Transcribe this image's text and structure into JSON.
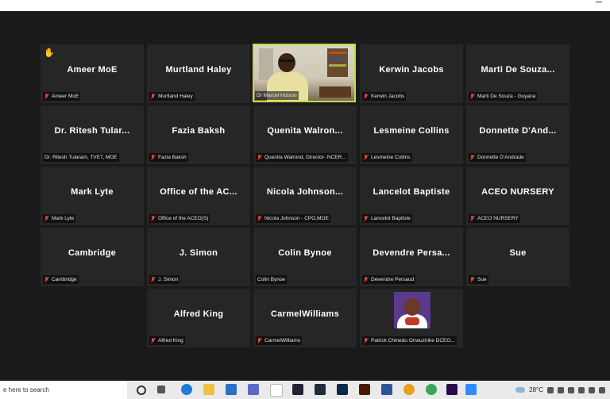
{
  "taskbar": {
    "search_placeholder": "e here to search",
    "weather": "28°C"
  },
  "colors": {
    "active_speaker_border": "#c8d93b",
    "muted_mic": "#e0403a",
    "tile_bg": "#262626",
    "stage_bg": "#1a1a1a"
  },
  "tiles": [
    {
      "name": "Ameer MoE",
      "label": "Ameer MoE",
      "muted": true,
      "hand": true
    },
    {
      "name": "Murtland Haley",
      "label": "Murtland Haley",
      "muted": true
    },
    {
      "name": "",
      "label": "Dr Marcel Hutson",
      "muted": false,
      "video": true
    },
    {
      "name": "Kerwin Jacobs",
      "label": "Kerwin Jacobs",
      "muted": true
    },
    {
      "name": "Marti De Souza...",
      "label": "Marti De Souza - Guyana",
      "muted": true
    },
    {
      "name": "Dr. Ritesh Tular...",
      "label": "Dr. Ritesh Tularam, TVET, MOE",
      "muted": false
    },
    {
      "name": "Fazia Baksh",
      "label": "Fazia Baksh",
      "muted": true
    },
    {
      "name": "Quenita Walron...",
      "label": "Quenita Walrond, Director- NCER...",
      "muted": true
    },
    {
      "name": "Lesmeine Collins",
      "label": "Lesmeine Collins",
      "muted": true
    },
    {
      "name": "Donnette D'And...",
      "label": "Donnette D'Andrade",
      "muted": true
    },
    {
      "name": "Mark Lyte",
      "label": "Mark Lyte",
      "muted": true
    },
    {
      "name": "Office of the AC...",
      "label": "Office of the ACEO(S)",
      "muted": true
    },
    {
      "name": "Nicola Johnson...",
      "label": "Nicola Johnson - CPO,MOE",
      "muted": true
    },
    {
      "name": "Lancelot Baptiste",
      "label": "Lancelot Baptiste",
      "muted": true
    },
    {
      "name": "ACEO NURSERY",
      "label": "ACEO NURSERY",
      "muted": true
    },
    {
      "name": "Cambridge",
      "label": "Cambridge",
      "muted": true
    },
    {
      "name": "J. Simon",
      "label": "J. Simon",
      "muted": true
    },
    {
      "name": "Colin Bynoe",
      "label": "Colin Bynoe",
      "muted": false
    },
    {
      "name": "Devendre Persa...",
      "label": "Devendre Persaud",
      "muted": true
    },
    {
      "name": "Sue",
      "label": "Sue",
      "muted": true
    },
    {
      "name": "Alfred King",
      "label": "Alfred King",
      "muted": true
    },
    {
      "name": "CarmelWilliams",
      "label": "CarmelWilliams",
      "muted": true
    },
    {
      "name": "",
      "label": "Patrick Chinedu Onwuzirike DCEO...",
      "muted": true,
      "avatar": true
    }
  ]
}
